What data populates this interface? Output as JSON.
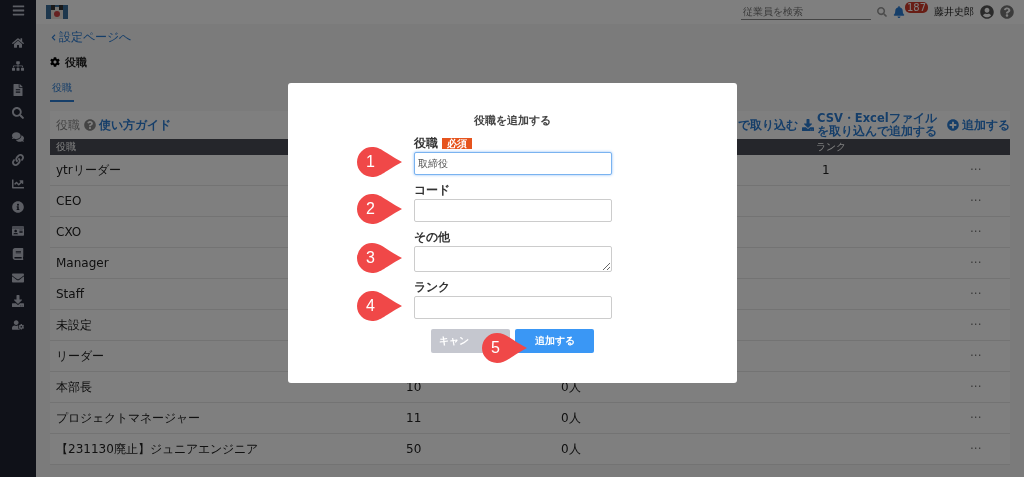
{
  "topbar": {
    "search": {
      "placeholder": "従業員を検索"
    },
    "notification_count": "187",
    "user_name": "藤井史郎"
  },
  "breadcrumb": "設定ページへ",
  "page_title": "役職",
  "tabs": [
    {
      "label": "役職",
      "selected": true
    }
  ],
  "toolbar": {
    "title": "役職",
    "guide_link": "使い方ガイド",
    "actions": [
      {
        "kind": "plain",
        "label": "で取り込む"
      },
      {
        "kind": "download",
        "label": "CSV・Excelファイルを取り込んで追加する"
      },
      {
        "kind": "add",
        "label": "追加する"
      }
    ]
  },
  "table": {
    "columns": [
      {
        "label": "役職"
      },
      {
        "label": "ランク"
      }
    ],
    "rows": [
      {
        "name": "ytrリーダー",
        "rank": "1",
        "menu": "···"
      },
      {
        "name": "CEO",
        "menu": "···"
      },
      {
        "name": "CXO",
        "menu": "···"
      },
      {
        "name": "Manager",
        "menu": "···"
      },
      {
        "name": "Staff",
        "menu": "···"
      },
      {
        "name": "未設定",
        "menu": "···"
      },
      {
        "name": "リーダー",
        "menu": "···"
      },
      {
        "name": "本部長",
        "code": "10",
        "count": "0人",
        "menu": "···"
      },
      {
        "name": "プロジェクトマネージャー",
        "code": "11",
        "count": "0人",
        "menu": "···"
      },
      {
        "name": "【231130廃止】ジュニアエンジニア",
        "code": "50",
        "count": "0人",
        "menu": "···"
      }
    ]
  },
  "dialog": {
    "title": "役職を追加する",
    "fields": [
      {
        "kind": "input",
        "label": "役職",
        "badge": "必須",
        "value": "取締役",
        "focused": true
      },
      {
        "kind": "input",
        "label": "コード",
        "focused": false
      },
      {
        "kind": "textarea",
        "label": "その他",
        "focused": false
      },
      {
        "kind": "input",
        "label": "ランク",
        "focused": false
      }
    ],
    "cancel_button": "キャン",
    "submit_button": "追加する"
  },
  "markers": [
    {
      "number": "1"
    },
    {
      "number": "2"
    },
    {
      "number": "3"
    },
    {
      "number": "4"
    },
    {
      "number": "5"
    }
  ]
}
